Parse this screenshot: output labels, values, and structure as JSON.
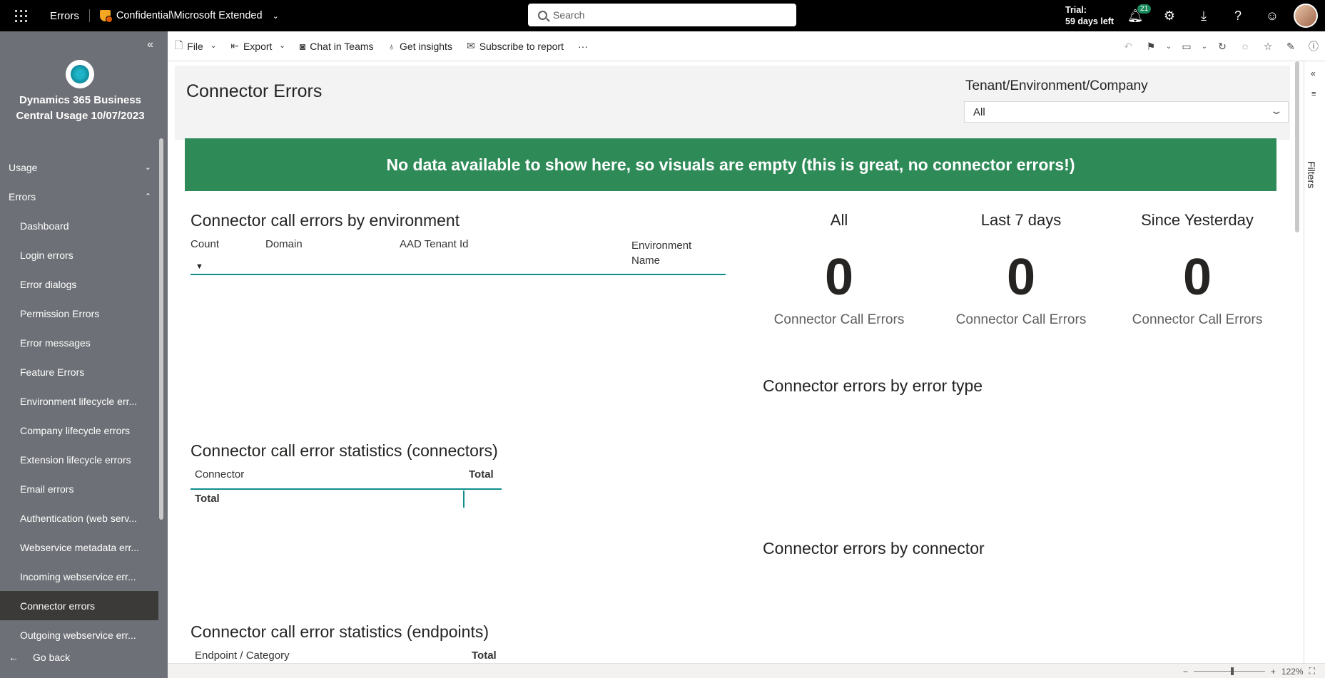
{
  "topbar": {
    "app_title": "Errors",
    "sensitivity": "Confidential\\Microsoft Extended",
    "search_placeholder": "Search",
    "trial_line1": "Trial:",
    "trial_line2": "59 days left",
    "notifications_count": "21"
  },
  "sidebar": {
    "workspace_title": "Dynamics 365 Business Central Usage 10/07/2023",
    "items": [
      {
        "label": "Usage",
        "type": "section",
        "caret": "⌄"
      },
      {
        "label": "Errors",
        "type": "section",
        "caret": "⌃"
      },
      {
        "label": "Dashboard"
      },
      {
        "label": "Login errors"
      },
      {
        "label": "Error dialogs"
      },
      {
        "label": "Permission Errors"
      },
      {
        "label": "Error messages"
      },
      {
        "label": "Feature Errors"
      },
      {
        "label": "Environment lifecycle err..."
      },
      {
        "label": "Company lifecycle errors"
      },
      {
        "label": "Extension lifecycle errors"
      },
      {
        "label": "Email errors"
      },
      {
        "label": "Authentication (web serv..."
      },
      {
        "label": "Webservice metadata err..."
      },
      {
        "label": "Incoming webservice err..."
      },
      {
        "label": "Connector errors",
        "active": true
      },
      {
        "label": "Outgoing webservice err..."
      }
    ],
    "go_back": "Go back"
  },
  "actionbar": {
    "file": "File",
    "export": "Export",
    "chat": "Chat in Teams",
    "insights": "Get insights",
    "subscribe": "Subscribe to report",
    "more": "···"
  },
  "page": {
    "title": "Connector Errors",
    "slicer_label": "Tenant/Environment/Company",
    "slicer_value": "All",
    "banner": "No data available to show here, so visuals are empty (this is great, no connector errors!)"
  },
  "env_table": {
    "title": "Connector call errors by environment",
    "columns": [
      "Count",
      "Domain",
      "AAD Tenant Id",
      "Environment Name"
    ]
  },
  "cards": [
    {
      "header": "All",
      "value": "0",
      "label": "Connector Call Errors"
    },
    {
      "header": "Last 7 days",
      "value": "0",
      "label": "Connector Call Errors"
    },
    {
      "header": "Since Yesterday",
      "value": "0",
      "label": "Connector Call Errors"
    }
  ],
  "error_type_title": "Connector errors by error type",
  "by_connector_title": "Connector errors by connector",
  "stats_connectors": {
    "title": "Connector call error statistics (connectors)",
    "col1": "Connector",
    "col2": "Total",
    "total_row": "Total"
  },
  "stats_endpoints": {
    "title": "Connector call error statistics (endpoints)",
    "col1": "Endpoint / Category",
    "col2": "Total"
  },
  "filters_label": "Filters",
  "zoom": "122%"
}
